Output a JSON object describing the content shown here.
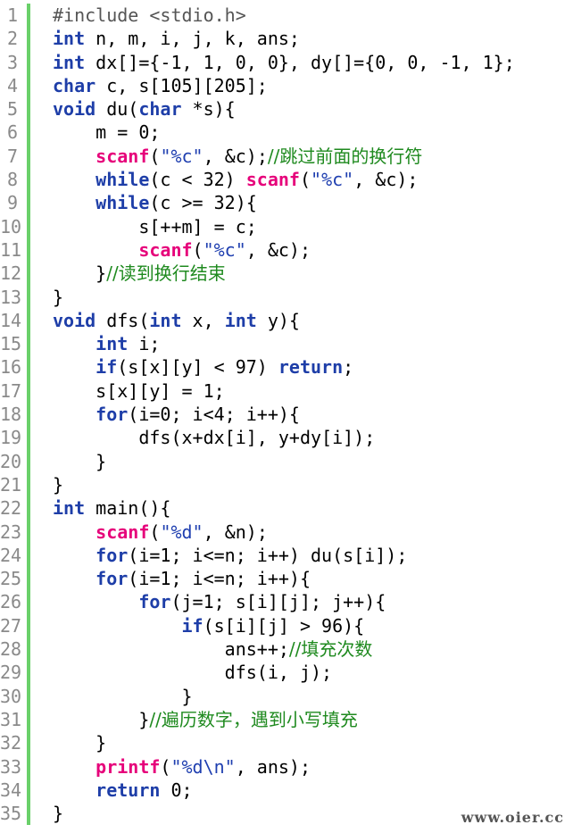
{
  "lines": [
    {
      "n": "1",
      "segments": [
        {
          "t": "#include <stdio.h>",
          "c": "pp"
        }
      ]
    },
    {
      "n": "2",
      "segments": [
        {
          "t": "int",
          "c": "kw"
        },
        {
          "t": " n, m, i, j, k, ans;",
          "c": ""
        }
      ]
    },
    {
      "n": "3",
      "segments": [
        {
          "t": "int",
          "c": "kw"
        },
        {
          "t": " dx[]={-1, 1, 0, 0}, dy[]={0, 0, -1, 1};",
          "c": ""
        }
      ]
    },
    {
      "n": "4",
      "segments": [
        {
          "t": "char",
          "c": "kw"
        },
        {
          "t": " c, s[105][205];",
          "c": ""
        }
      ]
    },
    {
      "n": "5",
      "segments": [
        {
          "t": "void",
          "c": "kw"
        },
        {
          "t": " du(",
          "c": ""
        },
        {
          "t": "char",
          "c": "kw"
        },
        {
          "t": " *s){",
          "c": ""
        }
      ]
    },
    {
      "n": "6",
      "segments": [
        {
          "t": "    m = 0;",
          "c": ""
        }
      ]
    },
    {
      "n": "7",
      "segments": [
        {
          "t": "    ",
          "c": ""
        },
        {
          "t": "scanf",
          "c": "fn"
        },
        {
          "t": "(",
          "c": ""
        },
        {
          "t": "\"%c\"",
          "c": "str"
        },
        {
          "t": ", &c);",
          "c": ""
        },
        {
          "t": "//跳过前面的换行符",
          "c": "cm"
        }
      ]
    },
    {
      "n": "8",
      "segments": [
        {
          "t": "    ",
          "c": ""
        },
        {
          "t": "while",
          "c": "kw"
        },
        {
          "t": "(c < 32) ",
          "c": ""
        },
        {
          "t": "scanf",
          "c": "fn"
        },
        {
          "t": "(",
          "c": ""
        },
        {
          "t": "\"%c\"",
          "c": "str"
        },
        {
          "t": ", &c);",
          "c": ""
        }
      ]
    },
    {
      "n": "9",
      "segments": [
        {
          "t": "    ",
          "c": ""
        },
        {
          "t": "while",
          "c": "kw"
        },
        {
          "t": "(c >= 32){",
          "c": ""
        }
      ]
    },
    {
      "n": "10",
      "segments": [
        {
          "t": "        s[++m] = c;",
          "c": ""
        }
      ]
    },
    {
      "n": "11",
      "segments": [
        {
          "t": "        ",
          "c": ""
        },
        {
          "t": "scanf",
          "c": "fn"
        },
        {
          "t": "(",
          "c": ""
        },
        {
          "t": "\"%c\"",
          "c": "str"
        },
        {
          "t": ", &c);",
          "c": ""
        }
      ]
    },
    {
      "n": "12",
      "segments": [
        {
          "t": "    }",
          "c": ""
        },
        {
          "t": "//读到换行结束",
          "c": "cm"
        }
      ]
    },
    {
      "n": "13",
      "segments": [
        {
          "t": "}",
          "c": ""
        }
      ]
    },
    {
      "n": "14",
      "segments": [
        {
          "t": "void",
          "c": "kw"
        },
        {
          "t": " dfs(",
          "c": ""
        },
        {
          "t": "int",
          "c": "kw"
        },
        {
          "t": " x, ",
          "c": ""
        },
        {
          "t": "int",
          "c": "kw"
        },
        {
          "t": " y){",
          "c": ""
        }
      ]
    },
    {
      "n": "15",
      "segments": [
        {
          "t": "    ",
          "c": ""
        },
        {
          "t": "int",
          "c": "kw"
        },
        {
          "t": " i;",
          "c": ""
        }
      ]
    },
    {
      "n": "16",
      "segments": [
        {
          "t": "    ",
          "c": ""
        },
        {
          "t": "if",
          "c": "kw"
        },
        {
          "t": "(s[x][y] < 97) ",
          "c": ""
        },
        {
          "t": "return",
          "c": "kw"
        },
        {
          "t": ";",
          "c": ""
        }
      ]
    },
    {
      "n": "17",
      "segments": [
        {
          "t": "    s[x][y] = 1;",
          "c": ""
        }
      ]
    },
    {
      "n": "18",
      "segments": [
        {
          "t": "    ",
          "c": ""
        },
        {
          "t": "for",
          "c": "kw"
        },
        {
          "t": "(i=0; i<4; i++){",
          "c": ""
        }
      ]
    },
    {
      "n": "19",
      "segments": [
        {
          "t": "        dfs(x+dx[i], y+dy[i]);",
          "c": ""
        }
      ]
    },
    {
      "n": "20",
      "segments": [
        {
          "t": "    }",
          "c": ""
        }
      ]
    },
    {
      "n": "21",
      "segments": [
        {
          "t": "}",
          "c": ""
        }
      ]
    },
    {
      "n": "22",
      "segments": [
        {
          "t": "int",
          "c": "kw"
        },
        {
          "t": " main(){",
          "c": ""
        }
      ]
    },
    {
      "n": "23",
      "segments": [
        {
          "t": "    ",
          "c": ""
        },
        {
          "t": "scanf",
          "c": "fn"
        },
        {
          "t": "(",
          "c": ""
        },
        {
          "t": "\"%d\"",
          "c": "str"
        },
        {
          "t": ", &n);",
          "c": ""
        }
      ]
    },
    {
      "n": "24",
      "segments": [
        {
          "t": "    ",
          "c": ""
        },
        {
          "t": "for",
          "c": "kw"
        },
        {
          "t": "(i=1; i<=n; i++) du(s[i]);",
          "c": ""
        }
      ]
    },
    {
      "n": "25",
      "segments": [
        {
          "t": "    ",
          "c": ""
        },
        {
          "t": "for",
          "c": "kw"
        },
        {
          "t": "(i=1; i<=n; i++){",
          "c": ""
        }
      ]
    },
    {
      "n": "26",
      "segments": [
        {
          "t": "        ",
          "c": ""
        },
        {
          "t": "for",
          "c": "kw"
        },
        {
          "t": "(j=1; s[i][j]; j++){",
          "c": ""
        }
      ]
    },
    {
      "n": "27",
      "segments": [
        {
          "t": "            ",
          "c": ""
        },
        {
          "t": "if",
          "c": "kw"
        },
        {
          "t": "(s[i][j] > 96){",
          "c": ""
        }
      ]
    },
    {
      "n": "28",
      "segments": [
        {
          "t": "                ans++;",
          "c": ""
        },
        {
          "t": "//填充次数",
          "c": "cm"
        }
      ]
    },
    {
      "n": "29",
      "segments": [
        {
          "t": "                dfs(i, j);",
          "c": ""
        }
      ]
    },
    {
      "n": "30",
      "segments": [
        {
          "t": "            }",
          "c": ""
        }
      ]
    },
    {
      "n": "31",
      "segments": [
        {
          "t": "        }",
          "c": ""
        },
        {
          "t": "//遍历数字，遇到小写填充",
          "c": "cm"
        }
      ]
    },
    {
      "n": "32",
      "segments": [
        {
          "t": "    }",
          "c": ""
        }
      ]
    },
    {
      "n": "33",
      "segments": [
        {
          "t": "    ",
          "c": ""
        },
        {
          "t": "printf",
          "c": "fn"
        },
        {
          "t": "(",
          "c": ""
        },
        {
          "t": "\"%d\\n\"",
          "c": "str"
        },
        {
          "t": ", ans);",
          "c": ""
        }
      ]
    },
    {
      "n": "34",
      "segments": [
        {
          "t": "    ",
          "c": ""
        },
        {
          "t": "return",
          "c": "kw"
        },
        {
          "t": " 0;",
          "c": ""
        }
      ]
    },
    {
      "n": "35",
      "segments": [
        {
          "t": "}",
          "c": ""
        }
      ]
    }
  ],
  "watermark": "www.oier.cc",
  "colors": {
    "keyword": "#1e3ea8",
    "function": "#e6007a",
    "string": "#1f3fb0",
    "comment": "#1f8a1f",
    "gutter_bar": "#6ad06a",
    "line_number": "#8a8a8a"
  }
}
